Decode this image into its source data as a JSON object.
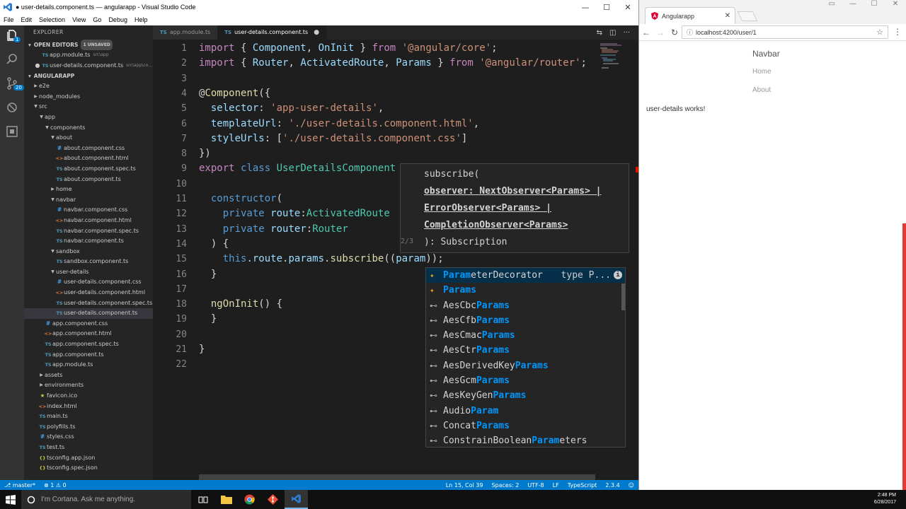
{
  "vscode": {
    "window_title": "● user-details.component.ts — angularapp - Visual Studio Code",
    "menu": [
      "File",
      "Edit",
      "Selection",
      "View",
      "Go",
      "Debug",
      "Help"
    ],
    "window_buttons": [
      "—",
      "☐",
      "✕"
    ],
    "activity_badges": {
      "explorer": "1",
      "scm": "20"
    },
    "sidebar": {
      "title": "EXPLORER",
      "open_editors_label": "OPEN EDITORS",
      "unsaved_badge": "1 UNSAVED",
      "open_editors": [
        {
          "name": "app.module.ts",
          "hint": "src\\app",
          "modified": false
        },
        {
          "name": "user-details.component.ts",
          "hint": "src\\app\\co...",
          "modified": true
        }
      ],
      "project_label": "ANGULARAPP",
      "tree": [
        {
          "name": "e2e",
          "type": "folder",
          "level": 1,
          "open": false
        },
        {
          "name": "node_modules",
          "type": "folder",
          "level": 1,
          "open": false
        },
        {
          "name": "src",
          "type": "folder",
          "level": 1,
          "open": true
        },
        {
          "name": "app",
          "type": "folder",
          "level": 2,
          "open": true
        },
        {
          "name": "components",
          "type": "folder",
          "level": 3,
          "open": true
        },
        {
          "name": "about",
          "type": "folder",
          "level": 4,
          "open": true
        },
        {
          "name": "about.component.css",
          "type": "css",
          "level": 5
        },
        {
          "name": "about.component.html",
          "type": "html",
          "level": 5
        },
        {
          "name": "about.component.spec.ts",
          "type": "ts",
          "level": 5
        },
        {
          "name": "about.component.ts",
          "type": "ts",
          "level": 5
        },
        {
          "name": "home",
          "type": "folder",
          "level": 4,
          "open": false
        },
        {
          "name": "navbar",
          "type": "folder",
          "level": 4,
          "open": true
        },
        {
          "name": "navbar.component.css",
          "type": "css",
          "level": 5
        },
        {
          "name": "navbar.component.html",
          "type": "html",
          "level": 5
        },
        {
          "name": "navbar.component.spec.ts",
          "type": "ts",
          "level": 5
        },
        {
          "name": "navbar.component.ts",
          "type": "ts",
          "level": 5
        },
        {
          "name": "sandbox",
          "type": "folder",
          "level": 4,
          "open": true
        },
        {
          "name": "sandbox.component.ts",
          "type": "ts",
          "level": 5
        },
        {
          "name": "user-details",
          "type": "folder",
          "level": 4,
          "open": true
        },
        {
          "name": "user-details.component.css",
          "type": "css",
          "level": 5
        },
        {
          "name": "user-details.component.html",
          "type": "html",
          "level": 5
        },
        {
          "name": "user-details.component.spec.ts",
          "type": "ts",
          "level": 5
        },
        {
          "name": "user-details.component.ts",
          "type": "ts",
          "level": 5,
          "selected": true
        },
        {
          "name": "app.component.css",
          "type": "css",
          "level": 3
        },
        {
          "name": "app.component.html",
          "type": "html",
          "level": 3
        },
        {
          "name": "app.component.spec.ts",
          "type": "ts",
          "level": 3
        },
        {
          "name": "app.component.ts",
          "type": "ts",
          "level": 3
        },
        {
          "name": "app.module.ts",
          "type": "ts",
          "level": 3
        },
        {
          "name": "assets",
          "type": "folder",
          "level": 2,
          "open": false
        },
        {
          "name": "environments",
          "type": "folder",
          "level": 2,
          "open": false
        },
        {
          "name": "favicon.ico",
          "type": "ico",
          "level": 2
        },
        {
          "name": "index.html",
          "type": "html",
          "level": 2
        },
        {
          "name": "main.ts",
          "type": "ts",
          "level": 2
        },
        {
          "name": "polyfills.ts",
          "type": "ts",
          "level": 2
        },
        {
          "name": "styles.css",
          "type": "css",
          "level": 2
        },
        {
          "name": "test.ts",
          "type": "ts",
          "level": 2
        },
        {
          "name": "tsconfig.app.json",
          "type": "json",
          "level": 2
        },
        {
          "name": "tsconfig.spec.json",
          "type": "json",
          "level": 2
        }
      ]
    },
    "tabs": [
      {
        "label": "app.module.ts",
        "active": false
      },
      {
        "label": "user-details.component.ts",
        "active": true
      }
    ],
    "code_lines": [
      {
        "n": "1",
        "tokens": [
          [
            "kw",
            "import"
          ],
          [
            "pl",
            " { "
          ],
          [
            "prop",
            "Component"
          ],
          [
            "pl",
            ", "
          ],
          [
            "prop",
            "OnInit"
          ],
          [
            "pl",
            " } "
          ],
          [
            "kw",
            "from"
          ],
          [
            "pl",
            " "
          ],
          [
            "str",
            "'@angular/core'"
          ],
          [
            "pl",
            ";"
          ]
        ]
      },
      {
        "n": "2",
        "tokens": [
          [
            "kw",
            "import"
          ],
          [
            "pl",
            " { "
          ],
          [
            "prop",
            "Router"
          ],
          [
            "pl",
            ", "
          ],
          [
            "prop",
            "ActivatedRoute"
          ],
          [
            "pl",
            ", "
          ],
          [
            "prop",
            "Params"
          ],
          [
            "pl",
            " } "
          ],
          [
            "kw",
            "from"
          ],
          [
            "pl",
            " "
          ],
          [
            "str",
            "'@angular/router'"
          ],
          [
            "pl",
            ";"
          ]
        ]
      },
      {
        "n": "3",
        "tokens": []
      },
      {
        "n": "4",
        "tokens": [
          [
            "pl",
            "@"
          ],
          [
            "fn",
            "Component"
          ],
          [
            "pl",
            "({"
          ]
        ]
      },
      {
        "n": "5",
        "tokens": [
          [
            "pl",
            "  "
          ],
          [
            "prop",
            "selector"
          ],
          [
            "pl",
            ": "
          ],
          [
            "str",
            "'app-user-details'"
          ],
          [
            "pl",
            ","
          ]
        ]
      },
      {
        "n": "6",
        "tokens": [
          [
            "pl",
            "  "
          ],
          [
            "prop",
            "templateUrl"
          ],
          [
            "pl",
            ": "
          ],
          [
            "str",
            "'./user-details.component.html'"
          ],
          [
            "pl",
            ","
          ]
        ]
      },
      {
        "n": "7",
        "tokens": [
          [
            "pl",
            "  "
          ],
          [
            "prop",
            "styleUrls"
          ],
          [
            "pl",
            ": ["
          ],
          [
            "str",
            "'./user-details.component.css'"
          ],
          [
            "pl",
            "]"
          ]
        ]
      },
      {
        "n": "8",
        "tokens": [
          [
            "pl",
            "})"
          ]
        ]
      },
      {
        "n": "9",
        "tokens": [
          [
            "kw",
            "export"
          ],
          [
            "pl",
            " "
          ],
          [
            "kw2",
            "class"
          ],
          [
            "pl",
            " "
          ],
          [
            "cls",
            "UserDetailsComponent"
          ]
        ]
      },
      {
        "n": "10",
        "tokens": []
      },
      {
        "n": "11",
        "tokens": [
          [
            "pl",
            "  "
          ],
          [
            "kw2",
            "constructor"
          ],
          [
            "pl",
            "("
          ]
        ]
      },
      {
        "n": "12",
        "tokens": [
          [
            "pl",
            "    "
          ],
          [
            "kw2",
            "private"
          ],
          [
            "pl",
            " "
          ],
          [
            "prop",
            "route"
          ],
          [
            "pl",
            ":"
          ],
          [
            "cls",
            "ActivatedRoute"
          ]
        ]
      },
      {
        "n": "13",
        "tokens": [
          [
            "pl",
            "    "
          ],
          [
            "kw2",
            "private"
          ],
          [
            "pl",
            " "
          ],
          [
            "prop",
            "router"
          ],
          [
            "pl",
            ":"
          ],
          [
            "cls",
            "Router"
          ]
        ]
      },
      {
        "n": "14",
        "tokens": [
          [
            "pl",
            "  ) {"
          ]
        ]
      },
      {
        "n": "15",
        "tokens": [
          [
            "pl",
            "    "
          ],
          [
            "kw2",
            "this"
          ],
          [
            "pl",
            "."
          ],
          [
            "prop",
            "route"
          ],
          [
            "pl",
            "."
          ],
          [
            "prop",
            "params"
          ],
          [
            "pl",
            "."
          ],
          [
            "fn",
            "subscribe"
          ],
          [
            "pl",
            "(("
          ],
          [
            "prop",
            "param"
          ],
          [
            "pl",
            "));"
          ]
        ]
      },
      {
        "n": "16",
        "tokens": [
          [
            "pl",
            "  }"
          ]
        ]
      },
      {
        "n": "17",
        "tokens": []
      },
      {
        "n": "18",
        "tokens": [
          [
            "pl",
            "  "
          ],
          [
            "fn",
            "ngOnInit"
          ],
          [
            "pl",
            "() {"
          ]
        ]
      },
      {
        "n": "19",
        "tokens": [
          [
            "pl",
            "  }"
          ]
        ]
      },
      {
        "n": "20",
        "tokens": []
      },
      {
        "n": "21",
        "tokens": [
          [
            "pl",
            "}"
          ]
        ]
      },
      {
        "n": "22",
        "tokens": []
      }
    ],
    "hover": {
      "lines": [
        {
          "text": "subscribe(",
          "underline": false
        },
        {
          "text": "observer: NextObserver<Params> |",
          "underline": true
        },
        {
          "text": "ErrorObserver<Params> |",
          "underline": true
        },
        {
          "text": "CompletionObserver<Params>",
          "underline": true
        },
        {
          "text": "): Subscription",
          "underline": false
        }
      ],
      "counter": "2/3"
    },
    "suggestions": [
      {
        "pre": "",
        "hl": "Param",
        "post": "eterDecorator",
        "icon": "class",
        "detail": "type P...",
        "selected": true
      },
      {
        "pre": "",
        "hl": "Params",
        "post": "",
        "icon": "class"
      },
      {
        "pre": "AesCbc",
        "hl": "Params",
        "post": "",
        "icon": "iface"
      },
      {
        "pre": "AesCfb",
        "hl": "Params",
        "post": "",
        "icon": "iface"
      },
      {
        "pre": "AesCmac",
        "hl": "Params",
        "post": "",
        "icon": "iface"
      },
      {
        "pre": "AesCtr",
        "hl": "Params",
        "post": "",
        "icon": "iface"
      },
      {
        "pre": "AesDerivedKey",
        "hl": "Params",
        "post": "",
        "icon": "iface"
      },
      {
        "pre": "AesGcm",
        "hl": "Params",
        "post": "",
        "icon": "iface"
      },
      {
        "pre": "AesKeyGen",
        "hl": "Params",
        "post": "",
        "icon": "iface"
      },
      {
        "pre": "Audio",
        "hl": "Param",
        "post": "",
        "icon": "iface"
      },
      {
        "pre": "Concat",
        "hl": "Params",
        "post": "",
        "icon": "iface"
      },
      {
        "pre": "ConstrainBoolean",
        "hl": "Param",
        "post": "eters",
        "icon": "iface"
      }
    ],
    "status": {
      "branch": "master*",
      "errors": "1",
      "warnings": "0",
      "position": "Ln 15, Col 39",
      "spaces": "Spaces: 2",
      "encoding": "UTF-8",
      "eol": "LF",
      "language": "TypeScript",
      "version": "2.3.4"
    }
  },
  "chrome": {
    "tab_title": "Angularapp",
    "url": "localhost:4200/user/1",
    "page": {
      "brand": "Navbar",
      "links": [
        "Home",
        "About"
      ],
      "content": "user-details works!"
    }
  },
  "taskbar": {
    "search_placeholder": "I'm Cortana. Ask me anything.",
    "time": "2:48 PM",
    "date": "6/28/2017"
  },
  "colors": {
    "editor_bg": "#1e1e1e",
    "sidebar_bg": "#252526",
    "statusbar": "#007acc",
    "match_highlight": "#0097fb"
  }
}
